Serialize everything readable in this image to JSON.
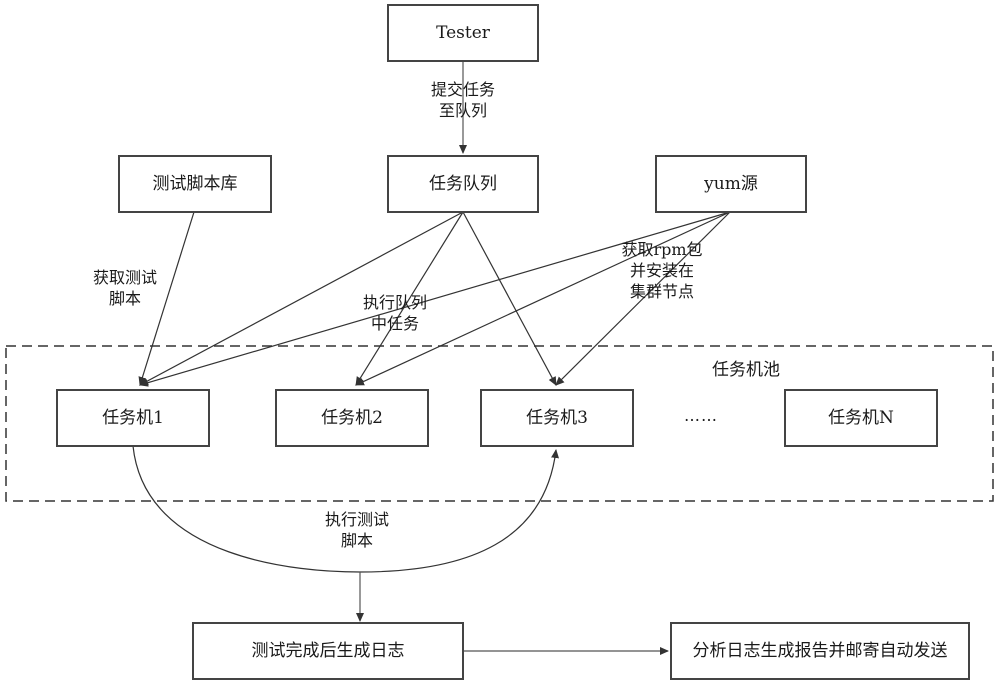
{
  "nodes": {
    "tester": "Tester",
    "script_repo": "测试脚本库",
    "task_queue": "任务队列",
    "yum_repo": "yum源",
    "worker_1": "任务机1",
    "worker_2": "任务机2",
    "worker_3": "任务机3",
    "worker_n": "任务机N",
    "ellipsis": "……",
    "generate_log": "测试完成后生成日志",
    "analyze_report": "分析日志生成报告并邮寄自动发送"
  },
  "group": {
    "pool_title": "任务机池"
  },
  "edges": {
    "submit_to_queue": [
      "提交任务",
      "至队列"
    ],
    "fetch_script": [
      "获取测试",
      "脚本"
    ],
    "execute_queue_task": [
      "执行队列",
      "中任务"
    ],
    "fetch_rpm": [
      "获取rpm包",
      "并安装在",
      "集群节点"
    ],
    "run_test_script": [
      "执行测试",
      "脚本"
    ]
  }
}
